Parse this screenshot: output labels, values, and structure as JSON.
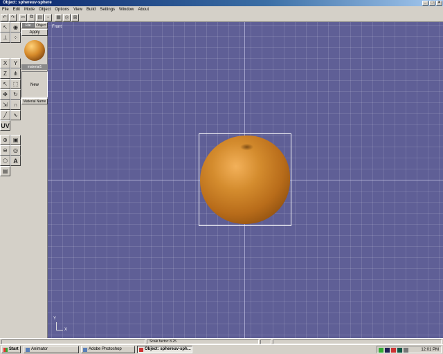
{
  "window": {
    "title": "Object: sphereuv-sphere",
    "btn_min": "_",
    "btn_max": "□",
    "btn_close": "×"
  },
  "menu": [
    "File",
    "Edit",
    "Mode",
    "Object",
    "Options",
    "View",
    "Build",
    "Settings",
    "Window",
    "About"
  ],
  "material_panel": {
    "tab_file": "File",
    "tab_object": "Object",
    "apply_label": "Apply",
    "material_label": "material1",
    "new_label": "New",
    "name_label": "Material Name"
  },
  "tool_glyphs": {
    "uv": "UV",
    "text": "A"
  },
  "viewport": {
    "view_name": "Front",
    "axis_y": "Y",
    "axis_x": "X",
    "background": "#5f5f96"
  },
  "status": {
    "scale_factor": "Scale factor: 8.25"
  },
  "taskbar": {
    "start_label": "Start",
    "tasks": [
      "Animator",
      "Adobe Photoshop",
      "Object: sphereuv-sph..."
    ],
    "clock": "12:01 PM"
  }
}
